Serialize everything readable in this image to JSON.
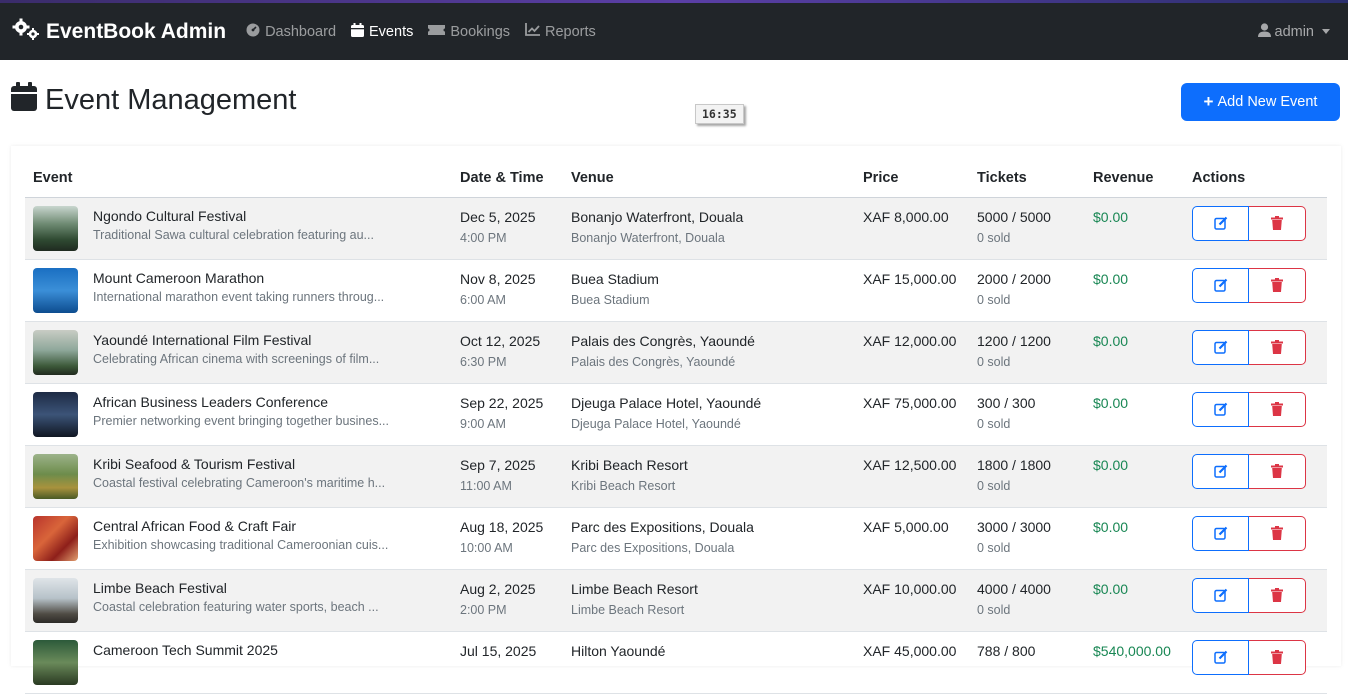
{
  "navbar": {
    "brand": "EventBook Admin",
    "links": [
      {
        "label": "Dashboard",
        "icon": "dashboard-icon",
        "active": false
      },
      {
        "label": "Events",
        "icon": "calendar-icon",
        "active": true
      },
      {
        "label": "Bookings",
        "icon": "ticket-icon",
        "active": false
      },
      {
        "label": "Reports",
        "icon": "chart-line-icon",
        "active": false
      }
    ],
    "user": "admin"
  },
  "page": {
    "title": "Event Management",
    "clock": "16:35",
    "add_button": "Add New Event"
  },
  "table": {
    "headers": [
      "Event",
      "Date & Time",
      "Venue",
      "Price",
      "Tickets",
      "Revenue",
      "Actions"
    ],
    "rows": [
      {
        "name": "Ngondo Cultural Festival",
        "desc": "Traditional Sawa cultural celebration featuring au...",
        "date": "Dec 5, 2025",
        "time": "4:00 PM",
        "venue": "Bonanjo Waterfront, Douala",
        "venue_sub": "Bonanjo Waterfront, Douala",
        "price": "XAF 8,000.00",
        "tickets": "5000 / 5000",
        "sold": "0 sold",
        "revenue": "$0.00"
      },
      {
        "name": "Mount Cameroon Marathon",
        "desc": "International marathon event taking runners throug...",
        "date": "Nov 8, 2025",
        "time": "6:00 AM",
        "venue": "Buea Stadium",
        "venue_sub": "Buea Stadium",
        "price": "XAF 15,000.00",
        "tickets": "2000 / 2000",
        "sold": "0 sold",
        "revenue": "$0.00"
      },
      {
        "name": "Yaoundé International Film Festival",
        "desc": "Celebrating African cinema with screenings of film...",
        "date": "Oct 12, 2025",
        "time": "6:30 PM",
        "venue": "Palais des Congrès, Yaoundé",
        "venue_sub": "Palais des Congrès, Yaoundé",
        "price": "XAF 12,000.00",
        "tickets": "1200 / 1200",
        "sold": "0 sold",
        "revenue": "$0.00"
      },
      {
        "name": "African Business Leaders Conference",
        "desc": "Premier networking event bringing together busines...",
        "date": "Sep 22, 2025",
        "time": "9:00 AM",
        "venue": "Djeuga Palace Hotel, Yaoundé",
        "venue_sub": "Djeuga Palace Hotel, Yaoundé",
        "price": "XAF 75,000.00",
        "tickets": "300 / 300",
        "sold": "0 sold",
        "revenue": "$0.00"
      },
      {
        "name": "Kribi Seafood & Tourism Festival",
        "desc": "Coastal festival celebrating Cameroon's maritime h...",
        "date": "Sep 7, 2025",
        "time": "11:00 AM",
        "venue": "Kribi Beach Resort",
        "venue_sub": "Kribi Beach Resort",
        "price": "XAF 12,500.00",
        "tickets": "1800 / 1800",
        "sold": "0 sold",
        "revenue": "$0.00"
      },
      {
        "name": "Central African Food & Craft Fair",
        "desc": "Exhibition showcasing traditional Cameroonian cuis...",
        "date": "Aug 18, 2025",
        "time": "10:00 AM",
        "venue": "Parc des Expositions, Douala",
        "venue_sub": "Parc des Expositions, Douala",
        "price": "XAF 5,000.00",
        "tickets": "3000 / 3000",
        "sold": "0 sold",
        "revenue": "$0.00"
      },
      {
        "name": "Limbe Beach Festival",
        "desc": "Coastal celebration featuring water sports, beach ...",
        "date": "Aug 2, 2025",
        "time": "2:00 PM",
        "venue": "Limbe Beach Resort",
        "venue_sub": "Limbe Beach Resort",
        "price": "XAF 10,000.00",
        "tickets": "4000 / 4000",
        "sold": "0 sold",
        "revenue": "$0.00"
      },
      {
        "name": "Cameroon Tech Summit 2025",
        "desc": "",
        "date": "Jul 15, 2025",
        "time": "",
        "venue": "Hilton Yaoundé",
        "venue_sub": "",
        "price": "XAF 45,000.00",
        "tickets": "788 / 800",
        "sold": "",
        "revenue": "$540,000.00"
      }
    ]
  },
  "colors": {
    "navbar_bg": "#212529",
    "primary": "#0d6efd",
    "danger": "#dc3545",
    "success": "#198754"
  }
}
